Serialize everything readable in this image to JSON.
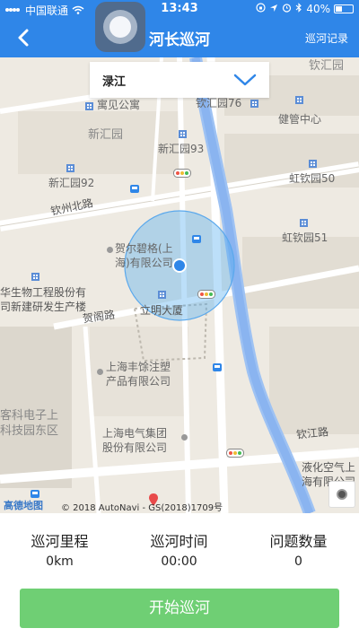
{
  "status_bar": {
    "carrier": "中国联通",
    "time": "13:43",
    "battery": "40%",
    "battery_level": 0.4
  },
  "nav": {
    "title": "河长巡河",
    "record_label": "巡河记录"
  },
  "river_select": {
    "value": "渌江"
  },
  "map": {
    "labels": {
      "yuqin_yuan": "钦汇园",
      "yuqin_yuan_76": "钦汇园76",
      "health_center": "健管中心",
      "yuguan_gongyu": "寓见公寓",
      "xinhui_yuan": "新汇园",
      "xinhui_yuan_93": "新汇园93",
      "xinhui_yuan_92": "新汇园92",
      "hongqin_yuan_50": "虹钦园50",
      "hongqin_yuan_51": "虹钦园51",
      "qinzhou_north_road": "钦州北路",
      "herbalife_1": "贺尔碧格(上",
      "herbalife_2": "海)有限公司",
      "bio_eng_1": "华生物工程股份有",
      "bio_eng_2": "司新建研发生产楼",
      "liming_building": "立明大厦",
      "hege_road": "贺阁路",
      "fengtu_1": "上海丰馀注塑",
      "fengtu_2": "产品有限公司",
      "tech_elec_1": "客科电子上",
      "tech_elec_2": "科技园东区",
      "electric_group_1": "上海电气集团",
      "electric_group_2": "股份有限公司",
      "qinjiang_road": "钦江路",
      "liquid_air_1": "液化空气上",
      "liquid_air_2": "海有限公司"
    },
    "logo": "高德地图",
    "copyright": "© 2018 AutoNavi - GS(2018)1709号"
  },
  "stats": [
    {
      "label": "巡河里程",
      "value": "0km"
    },
    {
      "label": "巡河时间",
      "value": "00:00"
    },
    {
      "label": "问题数量",
      "value": "0"
    }
  ],
  "start_button": {
    "label": "开始巡河"
  },
  "colors": {
    "primary_blue": "#2f86e8",
    "start_green": "#6fcf74",
    "river_blue": "#8ab4f0",
    "location_dot": "#2f86e8"
  }
}
